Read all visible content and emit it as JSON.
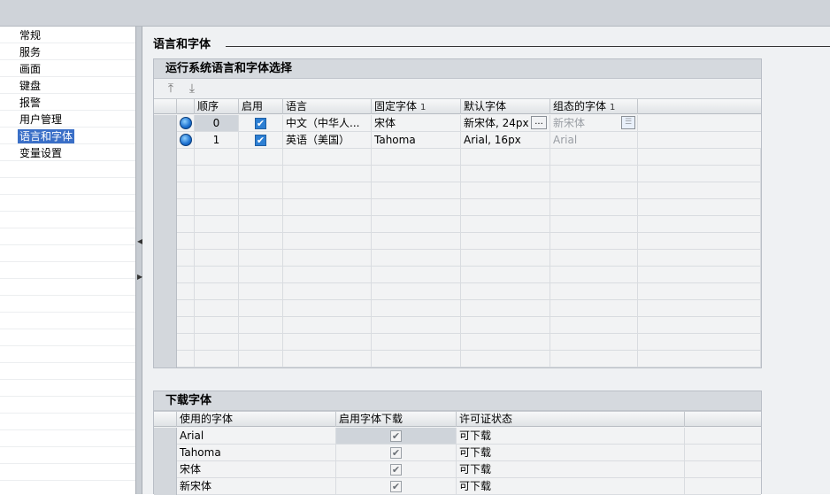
{
  "sidebar": {
    "items": [
      {
        "label": "常规"
      },
      {
        "label": "服务"
      },
      {
        "label": "画面"
      },
      {
        "label": "键盘"
      },
      {
        "label": "报警"
      },
      {
        "label": "用户管理"
      },
      {
        "label": "语言和字体",
        "selected": true
      },
      {
        "label": "变量设置"
      }
    ]
  },
  "page": {
    "title": "语言和字体"
  },
  "runtime_group": {
    "title": "运行系统语言和字体选择",
    "toolbar": {
      "move_up_icon": "arrow-up-to-line-icon",
      "move_down_icon": "arrow-down-to-line-icon"
    },
    "columns": {
      "order": "顺序",
      "enable": "启用",
      "language": "语言",
      "fixed_font": "固定字体",
      "fixed_font_sort": "1",
      "default_font": "默认字体",
      "config_font": "组态的字体",
      "config_font_sort": "1"
    },
    "rows": [
      {
        "order": "0",
        "enabled": true,
        "language": "中文（中华人...",
        "fixed_font": "宋体",
        "default_font": "新宋体, 24px",
        "config_font": "新宋体",
        "ellipsis": "..."
      },
      {
        "order": "1",
        "enabled": true,
        "language": "英语（美国）",
        "fixed_font": "Tahoma",
        "default_font": "Arial, 16px",
        "config_font": "Arial"
      }
    ]
  },
  "download_group": {
    "title": "下载字体",
    "columns": {
      "font": "使用的字体",
      "enable_download": "启用字体下载",
      "license": "许可证状态"
    },
    "rows": [
      {
        "font": "Arial",
        "enabled": true,
        "license": "可下载"
      },
      {
        "font": "Tahoma",
        "enabled": true,
        "license": "可下载"
      },
      {
        "font": "宋体",
        "enabled": true,
        "license": "可下载"
      },
      {
        "font": "新宋体",
        "enabled": true,
        "license": "可下载"
      }
    ]
  },
  "colors": {
    "selection": "#3a6fc7",
    "checkbox": "#2d7fd3"
  }
}
